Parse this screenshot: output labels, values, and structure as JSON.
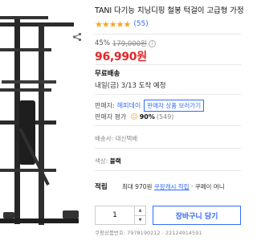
{
  "product": {
    "title": "TANI 다기능 치닝디핑 철봉 턱걸이 고급형 가정",
    "stars": "★★★★★",
    "review_count": "(55)",
    "share_icon": "share-icon"
  },
  "price": {
    "discount_rate": "45%",
    "original": "179,000원",
    "sale": "96,990원",
    "info_icon": "info-icon"
  },
  "shipping": {
    "title": "무료배송",
    "eta": "내일(금) 3/13 도착 예정"
  },
  "seller": {
    "label": "판매자:",
    "name": "헤피데이",
    "button": "판매자 상품 보러가기",
    "rating_label": "판매자 평가",
    "rating_pct": "90%",
    "rating_count": "(549)",
    "smile_icon": "smile-icon"
  },
  "delivery": {
    "method": "배송사: 대신택배"
  },
  "option": {
    "label": "색상:",
    "value": "블랙"
  },
  "rewards": {
    "label": "적립",
    "text": "최대 970원",
    "link": "쿠팡캐시 적립",
    "extra": "· 쿠페이 머니"
  },
  "purchase": {
    "quantity": "1",
    "cart_button": "장바구니 담기"
  },
  "product_id": "쿠팡상품번호: 7978190212 - 22124914591",
  "colors": {
    "accent": "#346aff",
    "sale": "#e52528",
    "star": "#f5a623"
  }
}
